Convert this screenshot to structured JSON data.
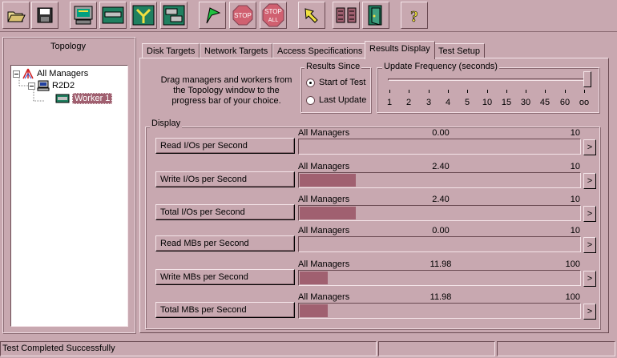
{
  "toolbar": {
    "buttons": [
      {
        "name": "open-icon"
      },
      {
        "name": "save-icon"
      },
      {
        "name": "display-icon"
      },
      {
        "name": "disk-worker-icon"
      },
      {
        "name": "network-worker-icon"
      },
      {
        "name": "duplicate-worker-icon"
      },
      {
        "name": "start-icon"
      },
      {
        "name": "stop-icon",
        "label": "STOP"
      },
      {
        "name": "stop-all-icon",
        "label": "STOP",
        "label2": "ALL"
      },
      {
        "name": "reset-icon"
      },
      {
        "name": "disconnect-icon"
      },
      {
        "name": "exit-icon"
      },
      {
        "name": "help-icon",
        "label": "?"
      }
    ]
  },
  "topology": {
    "title": "Topology",
    "tree": {
      "root": "All Managers",
      "manager": "R2D2",
      "worker": "Worker 1"
    }
  },
  "tabs": [
    {
      "label": "Disk Targets",
      "active": false
    },
    {
      "label": "Network Targets",
      "active": false
    },
    {
      "label": "Access Specifications",
      "active": false
    },
    {
      "label": "Results Display",
      "active": true
    },
    {
      "label": "Test Setup",
      "active": false
    }
  ],
  "instructions": "Drag managers and workers from the Topology window to the progress bar of your choice.",
  "results_since": {
    "title": "Results Since",
    "options": [
      {
        "label": "Start of Test",
        "selected": true
      },
      {
        "label": "Last Update",
        "selected": false
      }
    ]
  },
  "update_frequency": {
    "title": "Update Frequency (seconds)",
    "ticks": [
      "1",
      "2",
      "3",
      "4",
      "5",
      "10",
      "15",
      "30",
      "45",
      "60",
      "oo"
    ],
    "selected": "oo"
  },
  "display": {
    "title": "Display",
    "rows": [
      {
        "button": "Read I/Os per Second",
        "source": "All Managers",
        "value": "0.00",
        "max": "10",
        "fraction": 0.0
      },
      {
        "button": "Write I/Os per Second",
        "source": "All Managers",
        "value": "2.40",
        "max": "10",
        "fraction": 0.24
      },
      {
        "button": "Total I/Os per Second",
        "source": "All Managers",
        "value": "2.40",
        "max": "10",
        "fraction": 0.24
      },
      {
        "button": "Read MBs per Second",
        "source": "All Managers",
        "value": "0.00",
        "max": "10",
        "fraction": 0.0
      },
      {
        "button": "Write MBs per Second",
        "source": "All Managers",
        "value": "11.98",
        "max": "100",
        "fraction": 0.1198
      },
      {
        "button": "Total MBs per Second",
        "source": "All Managers",
        "value": "11.98",
        "max": "100",
        "fraction": 0.1198
      }
    ],
    "arrow": ">"
  },
  "status": {
    "message": "Test Completed Successfully"
  },
  "colors": {
    "face": "#c8a8b0",
    "bar_fill": "#a06070",
    "selection": "#a06070"
  }
}
